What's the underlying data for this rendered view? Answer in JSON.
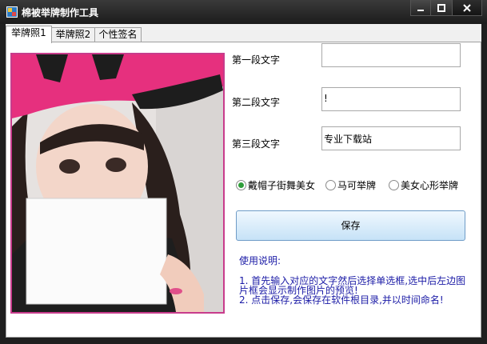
{
  "window": {
    "title": "棉被举牌制作工具",
    "buttons": [
      "—",
      "□",
      "✕"
    ]
  },
  "tabs": [
    {
      "label": "举牌照1",
      "active": true
    },
    {
      "label": "举牌照2",
      "active": false
    },
    {
      "label": "个性签名",
      "active": false
    }
  ],
  "form": {
    "field1_label": "第一段文字",
    "field1_value": "",
    "field2_label": "第二段文字",
    "field2_value": "!",
    "field3_label": "第三段文字",
    "field3_value": "专业下载站"
  },
  "radios": [
    {
      "label": "戴帽子街舞美女",
      "checked": true
    },
    {
      "label": "马可举牌",
      "checked": false
    },
    {
      "label": "美女心形举牌",
      "checked": false
    }
  ],
  "save_label": "保存",
  "instructions": {
    "heading": "使用说明:",
    "line1": "1. 首先输入对应的文字然后选择单选框,选中后左边图",
    "line2": "片框会显示制作图片的预览!",
    "line3": "2. 点击保存,会保存在软件根目录,并以时间命名!"
  },
  "colors": {
    "photo_border": "#c83c8c",
    "radio_checked": "#2f9d3a",
    "instruction_text": "#1a1aa6"
  }
}
